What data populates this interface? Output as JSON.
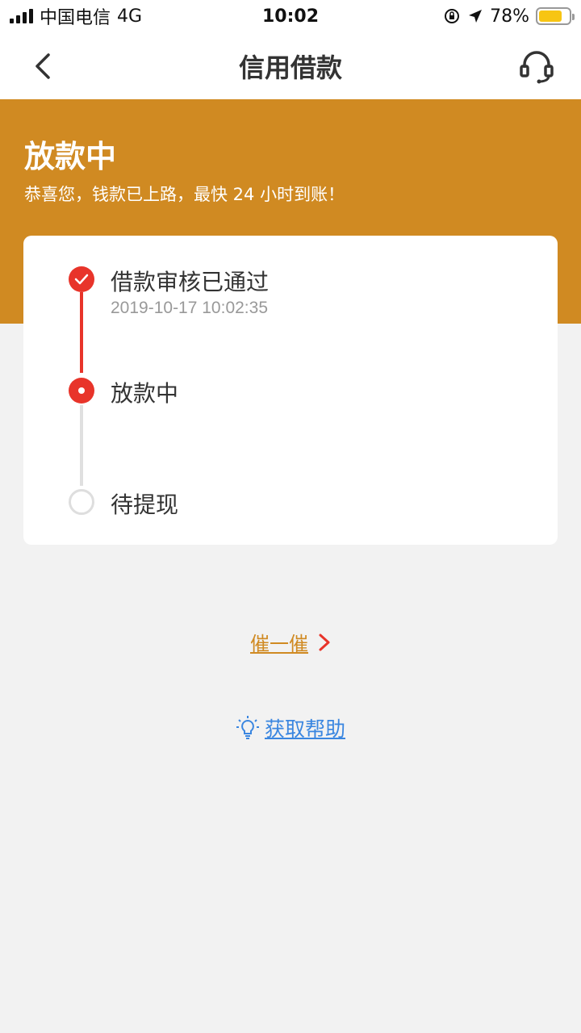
{
  "status_bar": {
    "carrier": "中国电信",
    "network": "4G",
    "time": "10:02",
    "battery": "78%",
    "battery_level": 0.78
  },
  "nav": {
    "title": "信用借款",
    "back_icon": "chevron-left-icon",
    "service_icon": "headset-icon"
  },
  "hero": {
    "title": "放款中",
    "subtitle": "恭喜您，钱款已上路，最快 24 小时到账！"
  },
  "steps": [
    {
      "title": "借款审核已通过",
      "date": "2019-10-17 10:02:35",
      "state": "done"
    },
    {
      "title": "放款中",
      "state": "current"
    },
    {
      "title": "待提现",
      "state": "pending"
    }
  ],
  "actions": {
    "urge_label": "催一催",
    "help_label": "获取帮助"
  },
  "colors": {
    "brand": "#d08a22",
    "active": "#e8342a",
    "link": "#3a86e0",
    "background": "#f2f2f2"
  }
}
